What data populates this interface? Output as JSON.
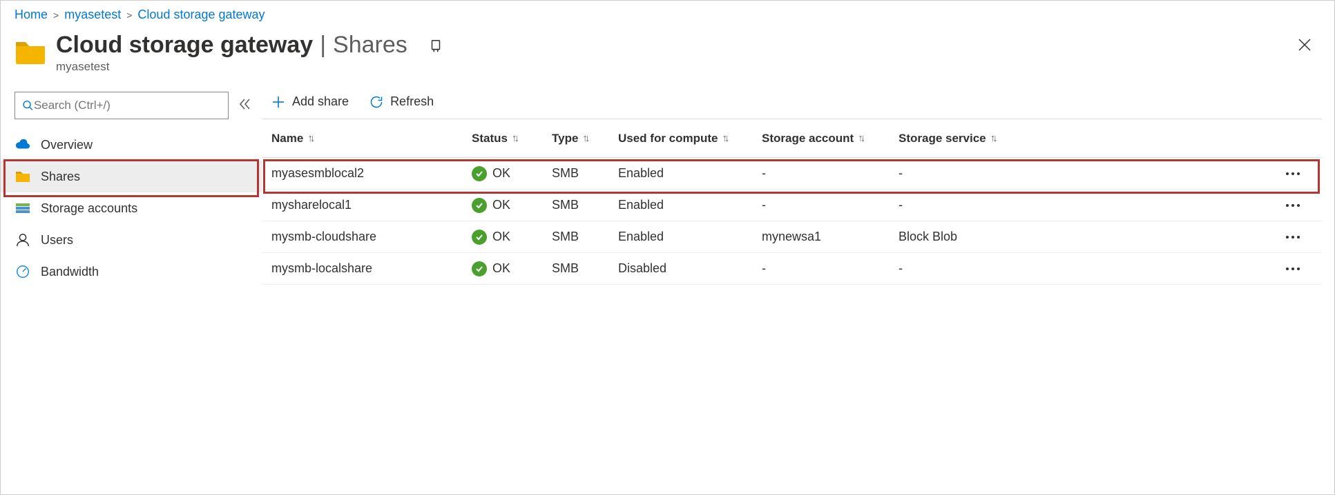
{
  "breadcrumb": {
    "home": "Home",
    "resource": "myasetest",
    "section": "Cloud storage gateway"
  },
  "header": {
    "title_primary": "Cloud storage gateway",
    "title_secondary": "Shares",
    "subtitle": "myasetest"
  },
  "search": {
    "placeholder": "Search (Ctrl+/)"
  },
  "nav": {
    "overview": "Overview",
    "shares": "Shares",
    "storage_accounts": "Storage accounts",
    "users": "Users",
    "bandwidth": "Bandwidth"
  },
  "toolbar": {
    "add_share": "Add share",
    "refresh": "Refresh"
  },
  "columns": {
    "name": "Name",
    "status": "Status",
    "type": "Type",
    "used_for_compute": "Used for compute",
    "storage_account": "Storage account",
    "storage_service": "Storage service"
  },
  "rows": [
    {
      "name": "myasesmblocal2",
      "status": "OK",
      "type": "SMB",
      "compute": "Enabled",
      "account": "-",
      "service": "-"
    },
    {
      "name": "mysharelocal1",
      "status": "OK",
      "type": "SMB",
      "compute": "Enabled",
      "account": "-",
      "service": "-"
    },
    {
      "name": "mysmb-cloudshare",
      "status": "OK",
      "type": "SMB",
      "compute": "Enabled",
      "account": "mynewsa1",
      "service": "Block Blob"
    },
    {
      "name": "mysmb-localshare",
      "status": "OK",
      "type": "SMB",
      "compute": "Disabled",
      "account": "-",
      "service": "-"
    }
  ]
}
